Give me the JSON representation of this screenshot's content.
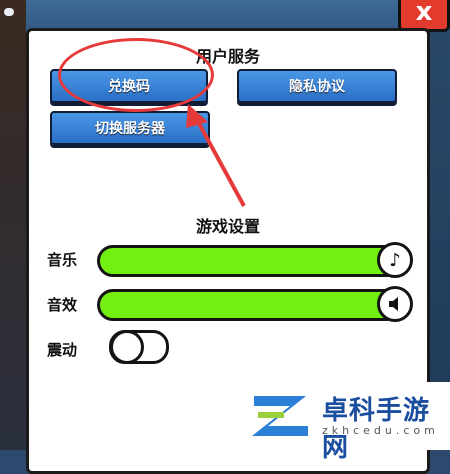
{
  "window": {
    "close_label": "x"
  },
  "user_services": {
    "title": "用户服务",
    "redeem_label": "兑换码",
    "privacy_label": "隐私协议",
    "switch_server_label": "切换服务器"
  },
  "game_settings": {
    "title": "游戏设置",
    "music": {
      "label": "音乐",
      "icon": "music-note-icon",
      "level": 100
    },
    "sound_effects": {
      "label": "音效",
      "icon": "speaker-icon",
      "level": 100
    },
    "vibration": {
      "label": "震动",
      "enabled": false
    }
  },
  "annotation": {
    "color": "#e63a3a"
  },
  "watermark": {
    "title": "卓科手游网",
    "url": "zkhcedu.com"
  },
  "colors": {
    "slider_fill": "#74f010",
    "button_blue": "#3a86d8",
    "close_red": "#e23b2e"
  }
}
